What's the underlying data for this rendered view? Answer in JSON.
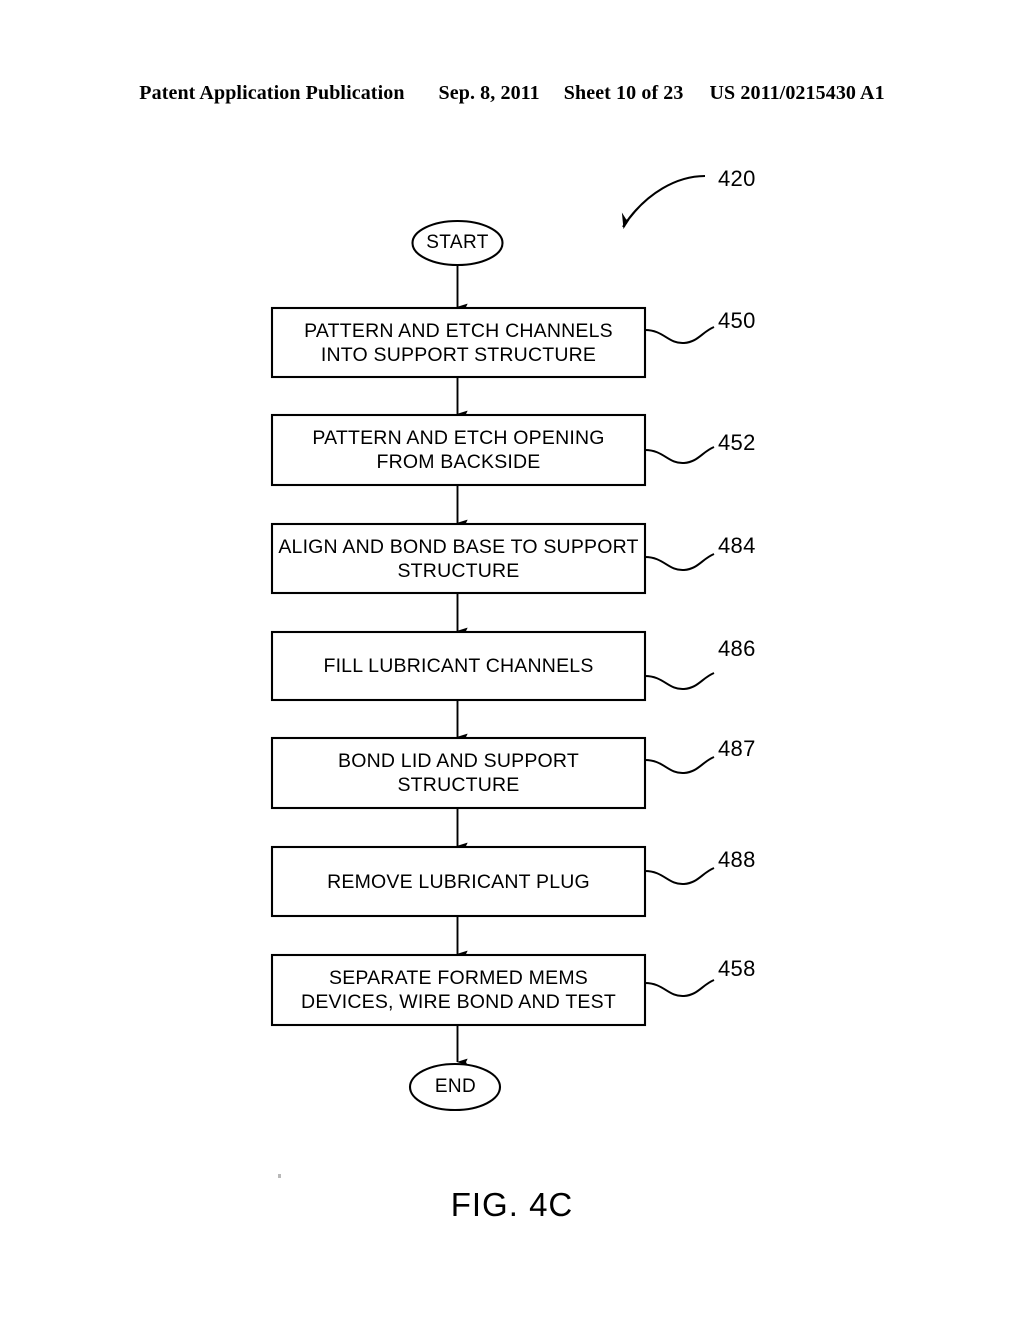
{
  "header": {
    "publication": "Patent Application Publication",
    "date": "Sep. 8, 2011",
    "sheet": "Sheet 10 of 23",
    "number": "US 2011/0215430 A1"
  },
  "figure": {
    "caption": "FIG. 4C",
    "diagram_reference": "420"
  },
  "flowchart": {
    "type": "process-flow",
    "start_label": "START",
    "end_label": "END",
    "steps": [
      {
        "ref": "450",
        "text": "PATTERN AND ETCH CHANNELS\nINTO SUPPORT STRUCTURE"
      },
      {
        "ref": "452",
        "text": "PATTERN AND ETCH OPENING\nFROM BACKSIDE"
      },
      {
        "ref": "484",
        "text": "ALIGN AND BOND BASE TO SUPPORT\nSTRUCTURE"
      },
      {
        "ref": "486",
        "text": "FILL LUBRICANT CHANNELS"
      },
      {
        "ref": "487",
        "text": "BOND LID AND SUPPORT\nSTRUCTURE"
      },
      {
        "ref": "488",
        "text": "REMOVE LUBRICANT PLUG"
      },
      {
        "ref": "458",
        "text": "SEPARATE FORMED MEMS\nDEVICES, WIRE BOND AND TEST"
      }
    ]
  },
  "colors": {
    "ink": "#000000",
    "paper": "#ffffff"
  }
}
